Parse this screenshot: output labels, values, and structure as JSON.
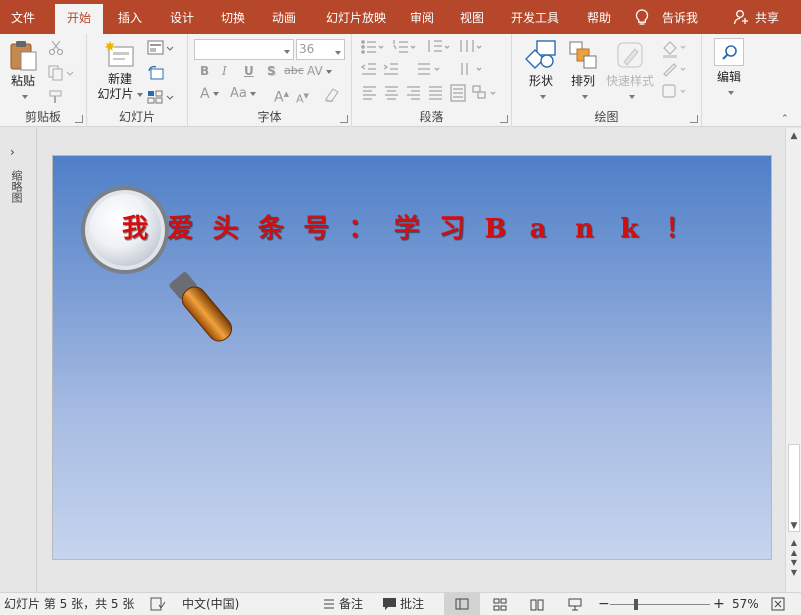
{
  "tabs": {
    "file": "文件",
    "home": "开始",
    "insert": "插入",
    "design": "设计",
    "transitions": "切换",
    "animations": "动画",
    "slideshow": "幻灯片放映",
    "review": "审阅",
    "view": "视图",
    "developer": "开发工具",
    "help": "帮助",
    "tellme": "告诉我",
    "share": "共享"
  },
  "ribbon": {
    "clipboard": {
      "label": "剪贴板",
      "paste": "粘贴"
    },
    "slides": {
      "label": "幻灯片",
      "new_slide_1": "新建",
      "new_slide_2": "幻灯片"
    },
    "font": {
      "label": "字体",
      "font_name": "",
      "font_size": "36",
      "bold": "B",
      "italic": "I",
      "underline": "U",
      "shadow": "S",
      "strike": "abc",
      "spacing": "AV",
      "color": "A",
      "case": "Aa",
      "grow": "A",
      "shrink": "A"
    },
    "paragraph": {
      "label": "段落"
    },
    "drawing": {
      "label": "绘图",
      "shapes": "形状",
      "arrange": "排列",
      "quick_styles": "快速样式"
    },
    "editing": {
      "label": "编辑"
    }
  },
  "thumb_pane": {
    "label": "缩略图"
  },
  "slide": {
    "text_chars": [
      "我",
      "爱",
      "头",
      "条",
      "号",
      "：",
      "学",
      "习",
      "B",
      "a",
      "n",
      "k",
      "！"
    ]
  },
  "status": {
    "slide_info": "幻灯片 第 5 张，共 5 张",
    "language": "中文(中国)",
    "notes": "备注",
    "comments": "批注",
    "zoom_minus": "−",
    "zoom_plus": "+",
    "zoom": "57%"
  },
  "colors": {
    "accent": "#b7472a",
    "slide_text": "#d20f0f"
  }
}
